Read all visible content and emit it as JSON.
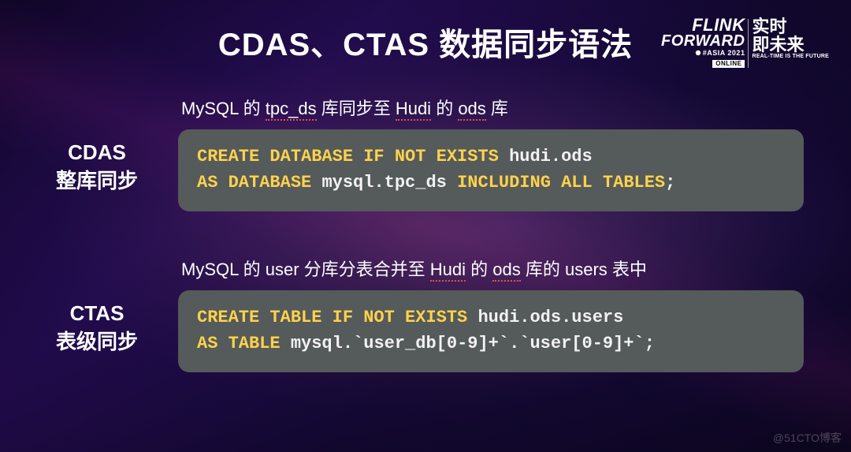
{
  "title": "CDAS、CTAS 数据同步语法",
  "logo": {
    "line1": "FLINK",
    "line2": "FORWARD",
    "asia": "#ASIA 2021",
    "online": "ONLINE",
    "cn_line1": "实时",
    "cn_line2": "即未来",
    "subtitle": "REAL-TIME IS THE FUTURE"
  },
  "sections": [
    {
      "label_line1": "CDAS",
      "label_line2": "整库同步",
      "desc_parts": [
        "MySQL 的 ",
        "tpc_ds",
        " 库同步至 ",
        "Hudi",
        " 的 ",
        "ods",
        " 库"
      ],
      "code_tokens": [
        {
          "t": "CREATE DATABASE IF NOT EXISTS",
          "c": "kw"
        },
        {
          "t": " ",
          "c": "id"
        },
        {
          "t": "hudi.ods",
          "c": "id"
        },
        {
          "t": "\n",
          "c": "id"
        },
        {
          "t": "AS DATABASE",
          "c": "kw"
        },
        {
          "t": " ",
          "c": "id"
        },
        {
          "t": "mysql.tpc_ds",
          "c": "id"
        },
        {
          "t": " ",
          "c": "id"
        },
        {
          "t": "INCLUDING ALL TABLES",
          "c": "kw"
        },
        {
          "t": ";",
          "c": "punct"
        }
      ]
    },
    {
      "label_line1": "CTAS",
      "label_line2": "表级同步",
      "desc_parts": [
        "MySQL 的  user 分库分表合并至  ",
        "Hudi",
        " 的 ",
        "ods",
        " 库的 users 表中"
      ],
      "code_tokens": [
        {
          "t": "CREATE TABLE IF NOT EXISTS",
          "c": "kw"
        },
        {
          "t": " ",
          "c": "id"
        },
        {
          "t": "hudi.ods.users",
          "c": "id"
        },
        {
          "t": "\n",
          "c": "id"
        },
        {
          "t": "AS TABLE",
          "c": "kw"
        },
        {
          "t": " ",
          "c": "id"
        },
        {
          "t": "mysql.`user_db[0-9]+`.`user[0-9]+`",
          "c": "id"
        },
        {
          "t": ";",
          "c": "punct"
        }
      ]
    }
  ],
  "watermark": "@51CTO博客"
}
